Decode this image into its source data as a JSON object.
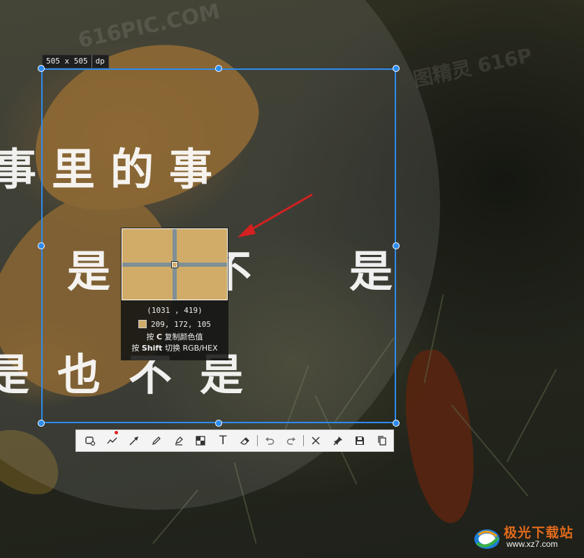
{
  "screenshot_tool": {
    "size_badge": {
      "dimensions": "505 x 505",
      "unit": "dp"
    },
    "magnifier": {
      "position": "(1031 , 419)",
      "rgb": "209, 172, 105",
      "color_hex": "#d1ac69",
      "hint_copy_prefix": "按 ",
      "hint_copy_key": "C",
      "hint_copy_suffix": " 复制颜色值",
      "hint_switch_prefix": "按 ",
      "hint_switch_key": "Shift",
      "hint_switch_suffix": " 切换 RGB/HEX"
    },
    "toolbar": {
      "tools": [
        {
          "name": "rectangle-icon"
        },
        {
          "name": "curve-icon"
        },
        {
          "name": "arrow-icon"
        },
        {
          "name": "pencil-icon"
        },
        {
          "name": "marker-icon"
        },
        {
          "name": "mosaic-icon"
        },
        {
          "name": "text-icon"
        },
        {
          "name": "eraser-icon"
        },
        {
          "name": "undo-icon"
        },
        {
          "name": "redo-icon"
        },
        {
          "name": "close-icon"
        },
        {
          "name": "pin-icon"
        },
        {
          "name": "save-icon"
        },
        {
          "name": "copy-icon"
        }
      ],
      "text_tool_label": "T"
    },
    "accent_color": "#2d8cf0",
    "annotation_color": "#d42020"
  },
  "background_image": {
    "line1": "事里的事",
    "line2": "是不是",
    "line3": "是也不是",
    "watermark_center": "616PIC.COM",
    "watermark_right": "图精灵 616P"
  },
  "site_logo": {
    "title": "极光下载站",
    "url": "www.xz7.com"
  }
}
